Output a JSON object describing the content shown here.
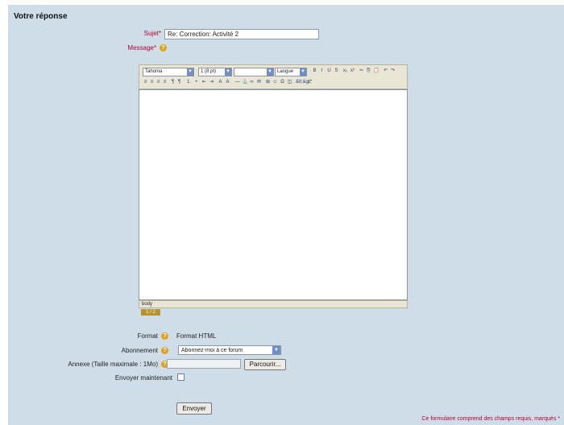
{
  "form": {
    "title": "Votre réponse",
    "subject_label": "Sujet*",
    "subject_value": "Re: Correction: Activité 2",
    "message_label": "Message*",
    "format_label": "Format",
    "format_value": "Format HTML",
    "subscription_label": "Abonnement",
    "subscription_value": "Abonnez-moi à ce forum",
    "attachment_label": "Annexe (Taille maximale : 1Mo)",
    "browse_button": "Parcourir...",
    "send_now_label": "Envoyer maintenant",
    "submit_button": "Envoyer",
    "required_note": "Ce formulaire comprend des champs requis, marqués *"
  },
  "editor": {
    "font_select": "Tahoma",
    "size_select": "1 (8 pt)",
    "style_select": "",
    "lang_select": "Langue",
    "status_path": "body",
    "chip_label": "1 / 2",
    "toolbar_row1": [
      "B",
      "I",
      "U",
      "S",
      "x₂",
      "x²",
      "✂",
      "⎘",
      "📋",
      "↶",
      "↷"
    ],
    "toolbar_row2": [
      "≡",
      "≡",
      "≡",
      "≡",
      "¶",
      "¶",
      "1.",
      "•",
      "⇤",
      "⇥",
      "A",
      "A",
      "—",
      "⚓",
      "∞",
      "✉",
      "⊞",
      "☺",
      "Ω",
      "◫",
      "&lt;&gt;",
      "⤢"
    ]
  },
  "icons": {
    "help": "help-icon",
    "dropdown": "chevron-down-icon"
  },
  "colors": {
    "background": "#cfdde9",
    "required": "#b3002d",
    "help_icon": "#e0a21a"
  }
}
